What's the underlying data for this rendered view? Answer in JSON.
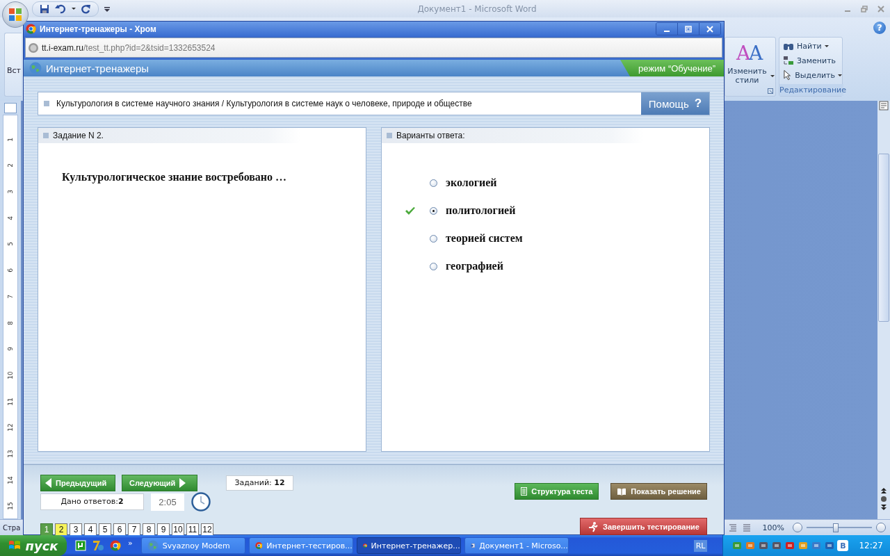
{
  "word": {
    "title": "Документ1 - Microsoft Word",
    "help_icon": "?",
    "insert_label": "Вст",
    "styles_icon": [
      "A",
      "A"
    ],
    "styles_button": "Изменить стили",
    "editing": {
      "items": [
        {
          "label": "Найти",
          "kind": "find",
          "caret": true
        },
        {
          "label": "Заменить",
          "kind": "replace",
          "caret": false
        },
        {
          "label": "Выделить",
          "kind": "select",
          "caret": true
        }
      ],
      "group_label": "Редактирование"
    },
    "ruler_marks": [
      "1",
      "2",
      "3",
      "4",
      "5",
      "6",
      "7",
      "8",
      "9",
      "10",
      "11",
      "12",
      "13",
      "14",
      "15"
    ],
    "status": {
      "page_label": "Стра",
      "zoom": "100%",
      "zoom_slider": {
        "level": 0.45
      }
    }
  },
  "browser": {
    "title": "Интернет-тренажеры - Хром",
    "url_host": "tt.i-exam.ru",
    "url_path": "/test_tt.php?id=2&tsid=1332653524"
  },
  "site": {
    "name": "Интернет-тренажеры",
    "mode": "режим “Обучение”",
    "breadcrumb": "Культурология в системе научного знания / Культурология в системе наук о человеке, природе и обществе",
    "help": "Помощь",
    "help_icon": "?",
    "task": {
      "heading": "Задание N 2.",
      "question": "Культурологическое знание востребовано …"
    },
    "answers": {
      "heading": "Варианты ответа:",
      "options": [
        {
          "label": "экологией",
          "selected": false,
          "marked_correct": false
        },
        {
          "label": "политологией",
          "selected": true,
          "marked_correct": true
        },
        {
          "label": "теорией систем",
          "selected": false,
          "marked_correct": false
        },
        {
          "label": "географией",
          "selected": false,
          "marked_correct": false
        }
      ]
    },
    "nav": {
      "prev": "Предыдущий",
      "next": "Следующий",
      "total": "Заданий: **12**",
      "given": "Дано ответов:**2**",
      "timer": "2:05"
    },
    "pages": [
      {
        "label": "1",
        "answered": true,
        "selected": false
      },
      {
        "label": "2",
        "answered": false,
        "selected": true
      },
      {
        "label": "3",
        "answered": false,
        "selected": false
      },
      {
        "label": "4",
        "answered": false,
        "selected": false
      },
      {
        "label": "5",
        "answered": false,
        "selected": false
      },
      {
        "label": "6",
        "answered": false,
        "selected": false
      },
      {
        "label": "7",
        "answered": false,
        "selected": false
      },
      {
        "label": "8",
        "answered": false,
        "selected": false
      },
      {
        "label": "9",
        "answered": false,
        "selected": false
      },
      {
        "label": "10",
        "answered": false,
        "selected": false
      },
      {
        "label": "11",
        "answered": false,
        "selected": false
      },
      {
        "label": "12",
        "answered": false,
        "selected": false
      }
    ],
    "actions": [
      {
        "label": "Структура теста",
        "kind": "structure"
      },
      {
        "label": "Показать решение",
        "kind": "solution"
      },
      {
        "label": "Завершить тестирование",
        "kind": "finish"
      }
    ]
  },
  "taskbar": {
    "start": "пуск",
    "more": "»",
    "tasks": [
      {
        "label": "Svyaznoy Modem",
        "kind": "modem",
        "selected": false
      },
      {
        "label": "Интернет-тестиров...",
        "kind": "chrome",
        "selected": false
      },
      {
        "label": "Интернет-тренажер...",
        "kind": "chrome",
        "selected": true
      },
      {
        "label": "Документ1 - Microso...",
        "kind": "word",
        "selected": false
      }
    ],
    "lang": "RL",
    "tray_letter": "В",
    "clock": "12:27"
  }
}
